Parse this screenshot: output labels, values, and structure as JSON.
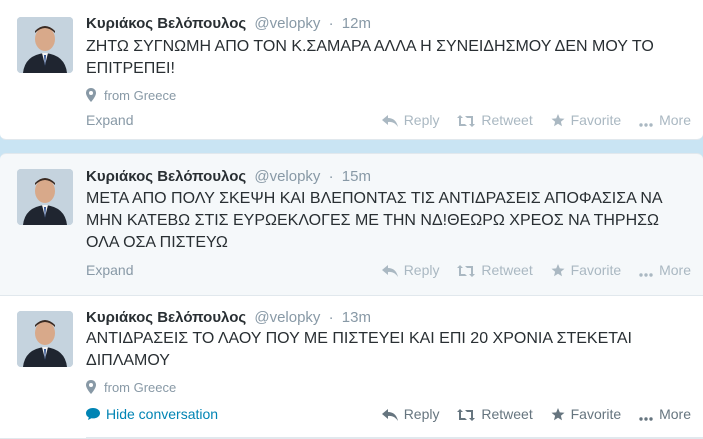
{
  "tweets": [
    {
      "fullname": "Κυριάκος Βελόπουλος",
      "username": "@velopky",
      "separator": "·",
      "time": "12m",
      "text": "ΖΗΤΩ ΣΥΓΝΩΜΗ ΑΠΟ ΤΟΝ Κ.ΣΑΜΑΡΑ ΑΛΛΑ Η ΣΥΝΕΙΔΗΣΜΟΥ ΔΕΝ ΜΟΥ ΤΟ ΕΠΙΤΡΕΠΕΙ!",
      "location": "from Greece",
      "expand": "Expand",
      "actions": {
        "reply": "Reply",
        "retweet": "Retweet",
        "favorite": "Favorite",
        "more": "More"
      }
    },
    {
      "fullname": "Κυριάκος Βελόπουλος",
      "username": "@velopky",
      "separator": "·",
      "time": "15m",
      "text": "ΜΕΤΑ  ΑΠΟ ΠΟΛΥ ΣΚΕΨΗ ΚΑΙ ΒΛΕΠΟΝΤΑΣ ΤΙΣ ΑΝΤΙΔΡΑΣΕΙΣ ΑΠΟΦΑΣΙΣΑ ΝΑ ΜΗΝ ΚΑΤΕΒΩ ΣΤΙΣ ΕΥΡΩΕΚΛΟΓΕΣ ΜΕ ΤΗΝ ΝΔ!ΘΕΩΡΩ ΧΡΕΟΣ ΝΑ ΤΗΡΗΣΩ ΟΛΑ ΟΣΑ ΠΙΣΤΕΥΩ",
      "expand": "Expand",
      "actions": {
        "reply": "Reply",
        "retweet": "Retweet",
        "favorite": "Favorite",
        "more": "More"
      }
    },
    {
      "fullname": "Κυριάκος Βελόπουλος",
      "username": "@velopky",
      "separator": "·",
      "time": "13m",
      "text": "ΑΝΤΙΔΡΑΣΕΙΣ ΤΟ ΛΑΟΥ ΠΟΥ ΜΕ ΠΙΣΤΕΥΕΙ ΚΑΙ ΕΠΙ 20 ΧΡΟΝΙΑ ΣΤΕΚΕΤΑΙ ΔΙΠΛΑΜΟΥ",
      "location": "from Greece",
      "hide_conversation": "Hide conversation",
      "actions": {
        "reply": "Reply",
        "retweet": "Retweet",
        "favorite": "Favorite",
        "more": "More"
      }
    }
  ],
  "colors": {
    "background": "#c9e4f3",
    "link": "#0084b4",
    "muted": "#8899a6",
    "text": "#292f33"
  },
  "icons": [
    "map-pin-icon",
    "reply-icon",
    "retweet-icon",
    "star-icon",
    "more-dots-icon",
    "conversation-bubble-icon"
  ]
}
